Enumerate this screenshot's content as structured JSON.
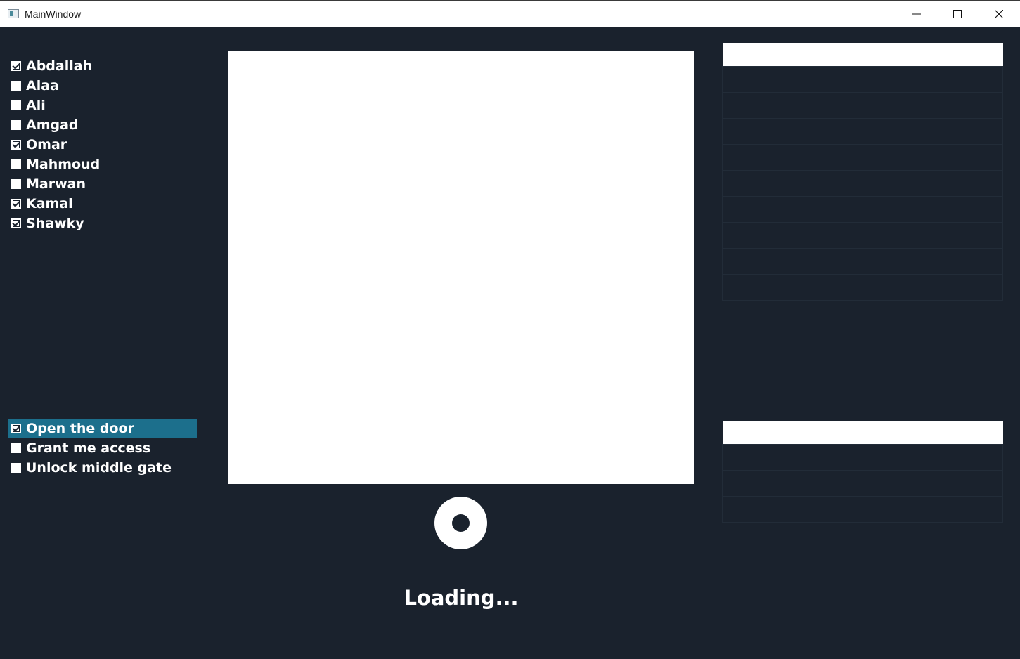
{
  "window": {
    "title": "MainWindow",
    "controls": [
      "minimize-icon",
      "maximize-icon",
      "close-icon"
    ]
  },
  "names": [
    {
      "label": "Abdallah",
      "checked": true
    },
    {
      "label": "Alaa",
      "checked": false
    },
    {
      "label": "Ali",
      "checked": false
    },
    {
      "label": "Amgad",
      "checked": false
    },
    {
      "label": "Omar",
      "checked": true
    },
    {
      "label": "Mahmoud",
      "checked": false
    },
    {
      "label": "Marwan",
      "checked": false
    },
    {
      "label": "Kamal",
      "checked": true
    },
    {
      "label": "Shawky",
      "checked": true
    }
  ],
  "actions": [
    {
      "label": "Open the door",
      "checked": true,
      "selected": true
    },
    {
      "label": "Grant me access",
      "checked": false,
      "selected": false
    },
    {
      "label": "Unlock middle gate",
      "checked": false,
      "selected": false
    }
  ],
  "status": {
    "loading": "Loading..."
  },
  "tables": {
    "top": {
      "columns": [
        "",
        ""
      ],
      "rows": 9
    },
    "bottom": {
      "columns": [
        "",
        ""
      ],
      "rows": 3
    }
  },
  "colors": {
    "background": "#1a222d",
    "selection": "#1c6f8c",
    "text": "#ffffff"
  }
}
